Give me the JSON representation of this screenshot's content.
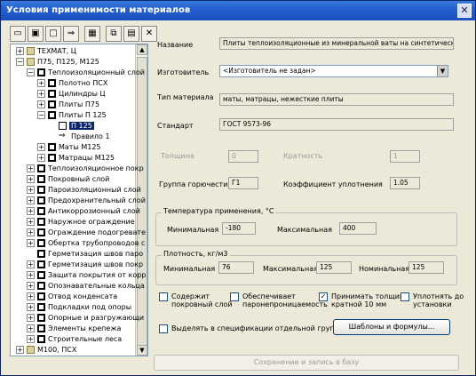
{
  "window": {
    "title": "Условия применимости материалов",
    "close_label": "✕"
  },
  "toolbar": {
    "buttons": [
      {
        "icon": "new-folder-icon",
        "glyph": "▭"
      },
      {
        "icon": "new-node-icon",
        "glyph": "▣"
      },
      {
        "icon": "new-item-icon",
        "glyph": "□"
      },
      {
        "icon": "arrow-right-icon",
        "glyph": "⇒"
      },
      {
        "icon": "table-icon",
        "glyph": "▦"
      },
      {
        "icon": "copy-icon",
        "glyph": "⧉"
      },
      {
        "icon": "paste-icon",
        "glyph": "▤"
      },
      {
        "icon": "delete-icon",
        "glyph": "✕"
      }
    ]
  },
  "tree": {
    "rows": [
      {
        "label": "ТЕХМАТ, Ц",
        "level": 0,
        "exp": "+",
        "icon": "folder"
      },
      {
        "label": "П75, П125, М125",
        "level": 0,
        "exp": "-",
        "icon": "folder"
      },
      {
        "label": "Теплоизоляционный слой",
        "level": 1,
        "exp": "-",
        "icon": "box"
      },
      {
        "label": "Полотно ПСХ",
        "level": 2,
        "exp": "+",
        "icon": "box"
      },
      {
        "label": "Цилиндры Ц",
        "level": 2,
        "exp": "+",
        "icon": "box"
      },
      {
        "label": "Плиты П75",
        "level": 2,
        "exp": "+",
        "icon": "box"
      },
      {
        "label": "Плиты П 125",
        "level": 2,
        "exp": "-",
        "icon": "box"
      },
      {
        "label": "П 125",
        "level": 3,
        "exp": "",
        "icon": "square",
        "selected": true
      },
      {
        "label": "Правило 1",
        "level": 3,
        "exp": "",
        "icon": "arrow"
      },
      {
        "label": "Маты М125",
        "level": 2,
        "exp": "+",
        "icon": "box"
      },
      {
        "label": "Матрацы М125",
        "level": 2,
        "exp": "+",
        "icon": "box"
      },
      {
        "label": "Теплоизоляционное покр",
        "level": 1,
        "exp": "+",
        "icon": "box"
      },
      {
        "label": "Покровный слой",
        "level": 1,
        "exp": "+",
        "icon": "box"
      },
      {
        "label": "Пароизоляционный слой",
        "level": 1,
        "exp": "+",
        "icon": "box"
      },
      {
        "label": "Предохранительный слой",
        "level": 1,
        "exp": "+",
        "icon": "box"
      },
      {
        "label": "Антикоррозионный слой",
        "level": 1,
        "exp": "+",
        "icon": "box"
      },
      {
        "label": "Наружное ограждение",
        "level": 1,
        "exp": "+",
        "icon": "box"
      },
      {
        "label": "Ограждение подогревате",
        "level": 1,
        "exp": "+",
        "icon": "box"
      },
      {
        "label": "Обертка трубопроводов с",
        "level": 1,
        "exp": "+",
        "icon": "box"
      },
      {
        "label": "Герметизация швов паро",
        "level": 1,
        "exp": "",
        "icon": "box"
      },
      {
        "label": "Герметизация швов покр",
        "level": 1,
        "exp": "+",
        "icon": "box"
      },
      {
        "label": "Защита покрытия от корр",
        "level": 1,
        "exp": "+",
        "icon": "box"
      },
      {
        "label": "Опознавательные кольца",
        "level": 1,
        "exp": "+",
        "icon": "box"
      },
      {
        "label": "Отвод конденсата",
        "level": 1,
        "exp": "+",
        "icon": "box"
      },
      {
        "label": "Подкладки под опоры",
        "level": 1,
        "exp": "+",
        "icon": "box"
      },
      {
        "label": "Опорные и разгружающи",
        "level": 1,
        "exp": "+",
        "icon": "box"
      },
      {
        "label": "Элементы крепежа",
        "level": 1,
        "exp": "+",
        "icon": "box"
      },
      {
        "label": "Строительные леса",
        "level": 1,
        "exp": "+",
        "icon": "box"
      },
      {
        "label": "М100, ПСХ",
        "level": 0,
        "exp": "+",
        "icon": "folder"
      }
    ]
  },
  "form": {
    "name_label": "Название",
    "name_value": "Плиты теплоизоляционные из минеральной ваты на синтетическом связующем",
    "manufacturer_label": "Изготовитель",
    "manufacturer_value": "<Изготовитель не задан>",
    "material_type_label": "Тип материала",
    "material_type_value": "маты, матрацы, нежесткие плиты",
    "standard_label": "Стандарт",
    "standard_value": "ГОСТ 9573-96",
    "thickness_label": "Толщина",
    "thickness_value": "0",
    "multiplicity_label": "Кратность",
    "multiplicity_value": "1",
    "flammability_label": "Группа горючести",
    "flammability_value": "Г1",
    "compaction_label": "Коэффициент уплотнения",
    "compaction_value": "1.05",
    "temp_group": {
      "title": "Температура применения, °С",
      "min_label": "Минимальная",
      "min_value": "-180",
      "max_label": "Максимальная",
      "max_value": "400"
    },
    "density_group": {
      "title": "Плотность, кг/м3",
      "min_label": "Минимальная",
      "min_value": "76",
      "max_label": "Максимальная",
      "max_value": "125",
      "nom_label": "Номинальная",
      "nom_value": "125"
    },
    "checkboxes": [
      {
        "label1": "Содержит",
        "label2": "покровный слой",
        "checked": false
      },
      {
        "label1": "Обеспечивает",
        "label2": "паронепроницаемость",
        "checked": false
      },
      {
        "label1": "Принимать толщину",
        "label2": "кратной 10 мм",
        "checked": true
      },
      {
        "label1": "Уплотнять до",
        "label2": "установки",
        "checked": false
      }
    ],
    "spec_checkbox_label": "Выделять в спецификации отдельной группой",
    "templates_button": "Шаблоны и формулы...",
    "save_button": "Сохранение и запись в базу"
  }
}
